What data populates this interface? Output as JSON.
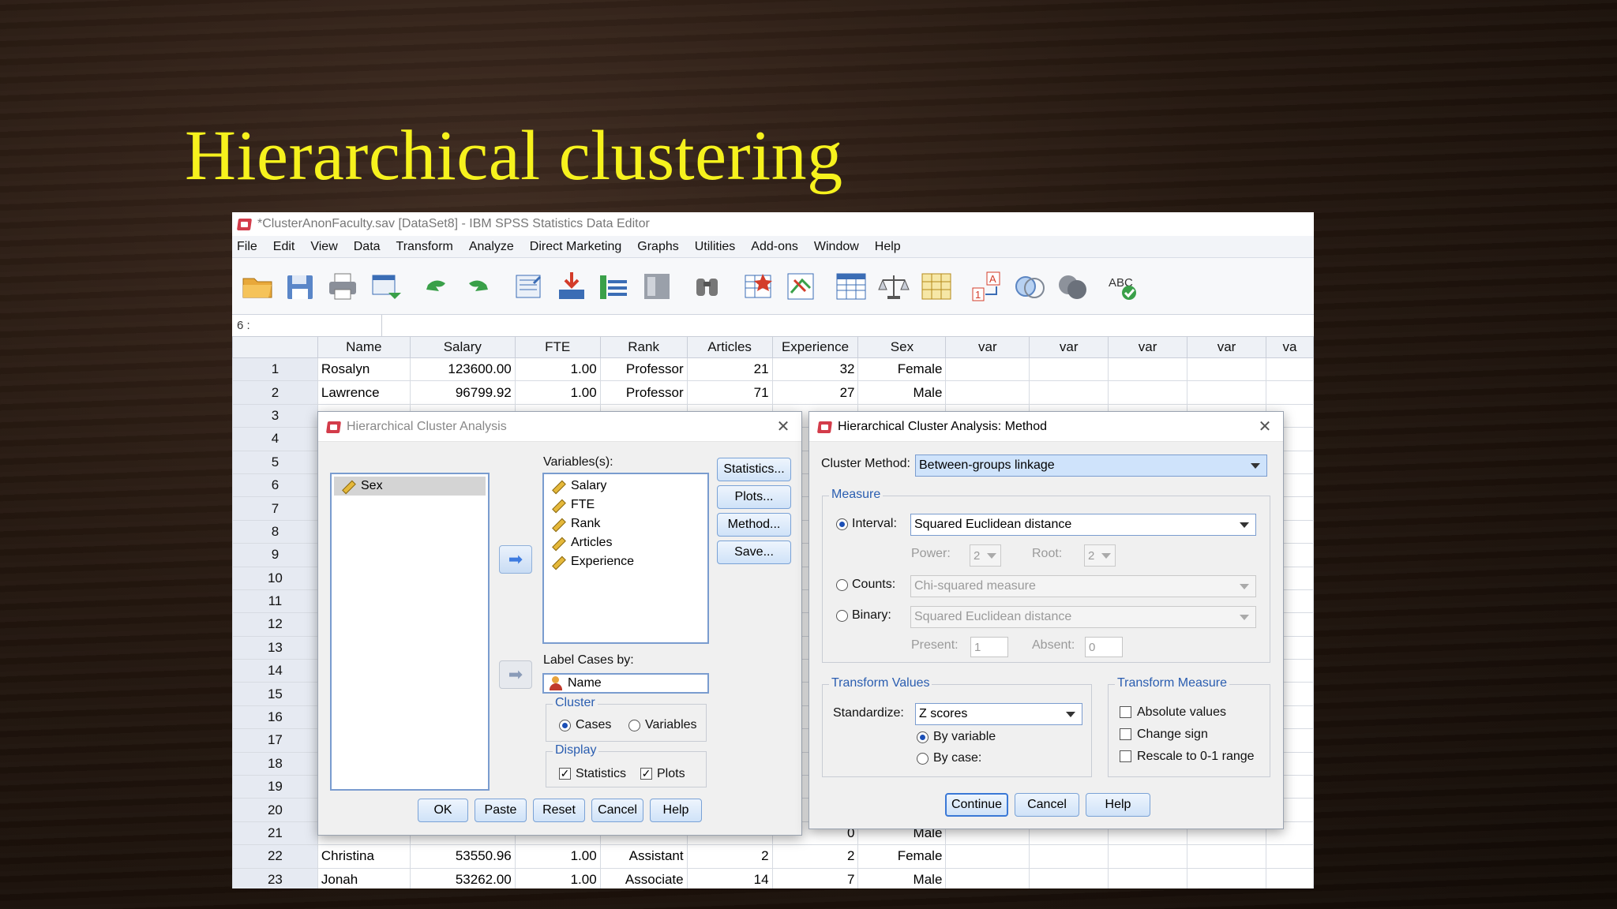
{
  "slide": {
    "title": "Hierarchical clustering"
  },
  "app": {
    "window_title": "*ClusterAnonFaculty.sav [DataSet8] - IBM SPSS Statistics Data Editor",
    "menu": [
      "File",
      "Edit",
      "View",
      "Data",
      "Transform",
      "Analyze",
      "Direct Marketing",
      "Graphs",
      "Utilities",
      "Add-ons",
      "Window",
      "Help"
    ],
    "toolbar_icons": [
      "open-folder-icon",
      "save-icon",
      "print-icon",
      "dialog-recall-icon",
      "undo-icon",
      "redo-icon",
      "goto-case-icon",
      "goto-variable-icon",
      "variables-icon",
      "run-descriptives-icon",
      "find-icon",
      "insert-cases-icon",
      "insert-variable-icon",
      "split-file-icon",
      "weight-cases-icon",
      "select-cases-icon",
      "value-labels-icon",
      "use-sets-icon",
      "show-all-variables-icon",
      "spell-check-icon"
    ],
    "cell_ref": "6 :",
    "cell_value": ""
  },
  "grid": {
    "columns": [
      "Name",
      "Salary",
      "FTE",
      "Rank",
      "Articles",
      "Experience",
      "Sex",
      "var",
      "var",
      "var",
      "var",
      "va"
    ],
    "rows": [
      {
        "n": "1",
        "name": "Rosalyn",
        "salary": "123600.00",
        "fte": "1.00",
        "rank": "Professor",
        "articles": "21",
        "exp": "32",
        "sex": "Female"
      },
      {
        "n": "2",
        "name": "Lawrence",
        "salary": "96799.92",
        "fte": "1.00",
        "rank": "Professor",
        "articles": "71",
        "exp": "27",
        "sex": "Male"
      },
      {
        "n": "3",
        "name": "",
        "salary": "",
        "fte": "",
        "rank": "",
        "articles": "",
        "exp": "",
        "sex": ""
      },
      {
        "n": "4",
        "name": "",
        "salary": "",
        "fte": "",
        "rank": "",
        "articles": "",
        "exp": "",
        "sex": ""
      },
      {
        "n": "5",
        "name": "",
        "salary": "",
        "fte": "",
        "rank": "",
        "articles": "",
        "exp": "",
        "sex": ""
      },
      {
        "n": "6",
        "name": "",
        "salary": "",
        "fte": "",
        "rank": "",
        "articles": "",
        "exp": "",
        "sex": ""
      },
      {
        "n": "7",
        "name": "",
        "salary": "",
        "fte": "",
        "rank": "",
        "articles": "",
        "exp": "",
        "sex": ""
      },
      {
        "n": "8",
        "name": "",
        "salary": "",
        "fte": "",
        "rank": "",
        "articles": "",
        "exp": "",
        "sex": ""
      },
      {
        "n": "9",
        "name": "",
        "salary": "",
        "fte": "",
        "rank": "",
        "articles": "",
        "exp": "",
        "sex": ""
      },
      {
        "n": "10",
        "name": "",
        "salary": "",
        "fte": "",
        "rank": "",
        "articles": "",
        "exp": "",
        "sex": ""
      },
      {
        "n": "11",
        "name": "",
        "salary": "",
        "fte": "",
        "rank": "",
        "articles": "",
        "exp": "",
        "sex": ""
      },
      {
        "n": "12",
        "name": "",
        "salary": "",
        "fte": "",
        "rank": "",
        "articles": "",
        "exp": "",
        "sex": ""
      },
      {
        "n": "13",
        "name": "",
        "salary": "",
        "fte": "",
        "rank": "",
        "articles": "",
        "exp": "",
        "sex": ""
      },
      {
        "n": "14",
        "name": "",
        "salary": "",
        "fte": "",
        "rank": "",
        "articles": "",
        "exp": "",
        "sex": ""
      },
      {
        "n": "15",
        "name": "",
        "salary": "",
        "fte": "",
        "rank": "",
        "articles": "",
        "exp": "",
        "sex": ""
      },
      {
        "n": "16",
        "name": "",
        "salary": "",
        "fte": "",
        "rank": "",
        "articles": "",
        "exp": "",
        "sex": ""
      },
      {
        "n": "17",
        "name": "",
        "salary": "",
        "fte": "",
        "rank": "",
        "articles": "",
        "exp": "",
        "sex": ""
      },
      {
        "n": "18",
        "name": "",
        "salary": "",
        "fte": "",
        "rank": "",
        "articles": "",
        "exp": "",
        "sex": ""
      },
      {
        "n": "19",
        "name": "",
        "salary": "",
        "fte": "",
        "rank": "",
        "articles": "",
        "exp": "",
        "sex": ""
      },
      {
        "n": "20",
        "name": "",
        "salary": "",
        "fte": "",
        "rank": "",
        "articles": "",
        "exp": "",
        "sex": ""
      },
      {
        "n": "21",
        "name": "",
        "salary": "",
        "fte": "",
        "rank": "",
        "articles": "",
        "exp": "0",
        "sex": "Male"
      },
      {
        "n": "22",
        "name": "Christina",
        "salary": "53550.96",
        "fte": "1.00",
        "rank": "Assistant",
        "articles": "2",
        "exp": "2",
        "sex": "Female"
      },
      {
        "n": "23",
        "name": "Jonah",
        "salary": "53262.00",
        "fte": "1.00",
        "rank": "Associate",
        "articles": "14",
        "exp": "7",
        "sex": "Male"
      }
    ]
  },
  "dialog_main": {
    "title": "Hierarchical Cluster Analysis",
    "source_list": [
      "Sex"
    ],
    "variables_label": "Variables(s):",
    "variables": [
      "Salary",
      "FTE",
      "Rank",
      "Articles",
      "Experience"
    ],
    "label_cases_label": "Label Cases by:",
    "label_cases_value": "Name",
    "buttons_side": [
      "Statistics...",
      "Plots...",
      "Method...",
      "Save..."
    ],
    "cluster_legend": "Cluster",
    "cluster_cases": "Cases",
    "cluster_variables": "Variables",
    "display_legend": "Display",
    "display_statistics": "Statistics",
    "display_plots": "Plots",
    "buttons_bottom": [
      "OK",
      "Paste",
      "Reset",
      "Cancel",
      "Help"
    ]
  },
  "dialog_method": {
    "title": "Hierarchical Cluster Analysis: Method",
    "cluster_method_label": "Cluster Method:",
    "cluster_method_value": "Between-groups linkage",
    "measure_legend": "Measure",
    "interval_label": "Interval:",
    "interval_value": "Squared Euclidean distance",
    "power_label": "Power:",
    "power_value": "2",
    "root_label": "Root:",
    "root_value": "2",
    "counts_label": "Counts:",
    "counts_value": "Chi-squared measure",
    "binary_label": "Binary:",
    "binary_value": "Squared Euclidean distance",
    "present_label": "Present:",
    "present_value": "1",
    "absent_label": "Absent:",
    "absent_value": "0",
    "transform_values_legend": "Transform Values",
    "standardize_label": "Standardize:",
    "standardize_value": "Z scores",
    "by_variable": "By variable",
    "by_case": "By case:",
    "transform_measure_legend": "Transform Measure",
    "absolute_values": "Absolute values",
    "change_sign": "Change sign",
    "rescale": "Rescale to 0-1 range",
    "buttons_bottom": [
      "Continue",
      "Cancel",
      "Help"
    ]
  }
}
